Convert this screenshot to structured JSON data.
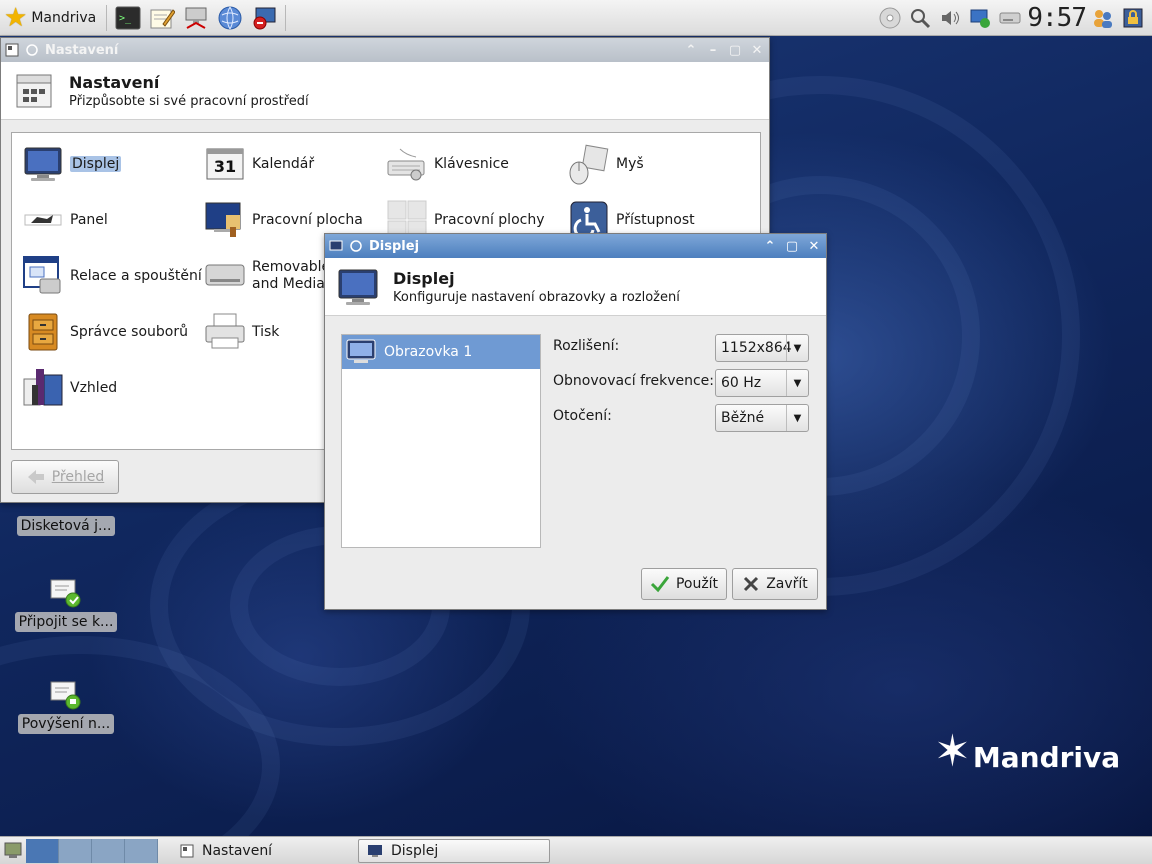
{
  "top_panel": {
    "menu_label": "Mandriva",
    "clock": "9:57",
    "launchers": [
      "terminal-icon",
      "text-editor-icon",
      "network-tool-icon",
      "browser-globe-icon",
      "remote-desktop-icon"
    ],
    "tray": [
      "disc-icon",
      "search-icon",
      "volume-icon",
      "network-status-icon",
      "drive-icon",
      "users-icon",
      "lock-icon"
    ]
  },
  "settings_window": {
    "title": "Nastavení",
    "header_title": "Nastavení",
    "header_subtitle": "Přizpůsobte si své pracovní prostředí",
    "items": [
      {
        "label": "Displej",
        "icon": "monitor-icon"
      },
      {
        "label": "Kalendář",
        "icon": "calendar-icon",
        "icon_text": "31"
      },
      {
        "label": "Klávesnice",
        "icon": "keyboard-icon"
      },
      {
        "label": "Myš",
        "icon": "mouse-icon"
      },
      {
        "label": "Panel",
        "icon": "panel-icon"
      },
      {
        "label": "Pracovní plocha",
        "icon": "desktop-icon"
      },
      {
        "label": "Pracovní plochy",
        "icon": "workspaces-icon"
      },
      {
        "label": "Přístupnost",
        "icon": "accessibility-icon"
      },
      {
        "label": "Relace a spouštění",
        "icon": "session-icon"
      },
      {
        "label": "Removable and Media",
        "label_line1": "Removable",
        "label_line2": "and Media",
        "icon": "removable-drive-icon"
      },
      {
        "label": "Správce souborů",
        "icon": "file-manager-icon"
      },
      {
        "label": "Tisk",
        "icon": "printer-icon"
      },
      {
        "label": "Vzhled",
        "icon": "appearance-icon"
      }
    ],
    "back_button": "Přehled"
  },
  "display_dialog": {
    "title": "Displej",
    "header_title": "Displej",
    "header_subtitle": "Konfiguruje nastavení obrazovky a rozložení",
    "monitor": "Obrazovka 1",
    "fields": {
      "resolution_label": "Rozlišení:",
      "resolution_value": "1152x864",
      "refresh_label": "Obnovovací frekvence:",
      "refresh_value": "60 Hz",
      "rotation_label": "Otočení:",
      "rotation_value": "Běžné"
    },
    "apply_button": "Použít",
    "close_button": "Zavřít"
  },
  "desktop_icons": [
    {
      "label": "Disketová j...",
      "icon": "floppy-icon"
    },
    {
      "label": "Připojit se k...",
      "icon": "connect-icon"
    },
    {
      "label": "Povýšení n...",
      "icon": "upgrade-icon"
    }
  ],
  "logo_text": "Mandriva",
  "taskbar": {
    "tasks": [
      {
        "label": "Nastavení",
        "active": false
      },
      {
        "label": "Displej",
        "active": true
      }
    ]
  }
}
